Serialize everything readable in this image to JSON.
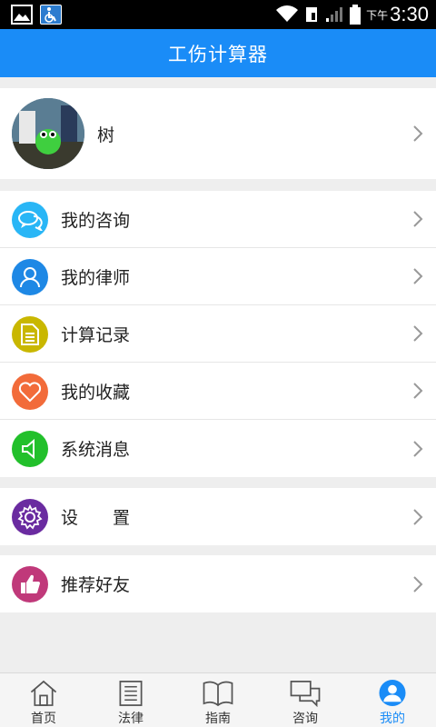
{
  "status_bar": {
    "ampm": "下午",
    "time": "3:30"
  },
  "header": {
    "title": "工伤计算器"
  },
  "profile": {
    "name": "树"
  },
  "menu": [
    {
      "label": "我的咨询",
      "icon": "chat-bubbles-icon",
      "color": "#29b6f6"
    },
    {
      "label": "我的律师",
      "icon": "person-icon",
      "color": "#1e88e5"
    },
    {
      "label": "计算记录",
      "icon": "document-icon",
      "color": "#c9b700"
    },
    {
      "label": "我的收藏",
      "icon": "heart-icon",
      "color": "#f26b3a"
    },
    {
      "label": "系统消息",
      "icon": "speaker-icon",
      "color": "#22c02b"
    }
  ],
  "settings": {
    "label": "设　　置",
    "icon": "gear-icon",
    "color": "#6a2ba0"
  },
  "recommend": {
    "label": "推荐好友",
    "icon": "thumbs-up-icon",
    "color": "#c0397a"
  },
  "tabs": [
    {
      "label": "首页",
      "icon": "home-icon"
    },
    {
      "label": "法律",
      "icon": "list-icon"
    },
    {
      "label": "指南",
      "icon": "book-icon"
    },
    {
      "label": "咨询",
      "icon": "chat-icon"
    },
    {
      "label": "我的",
      "icon": "user-icon",
      "active": true
    }
  ],
  "colors": {
    "accent": "#1a8cf7"
  }
}
